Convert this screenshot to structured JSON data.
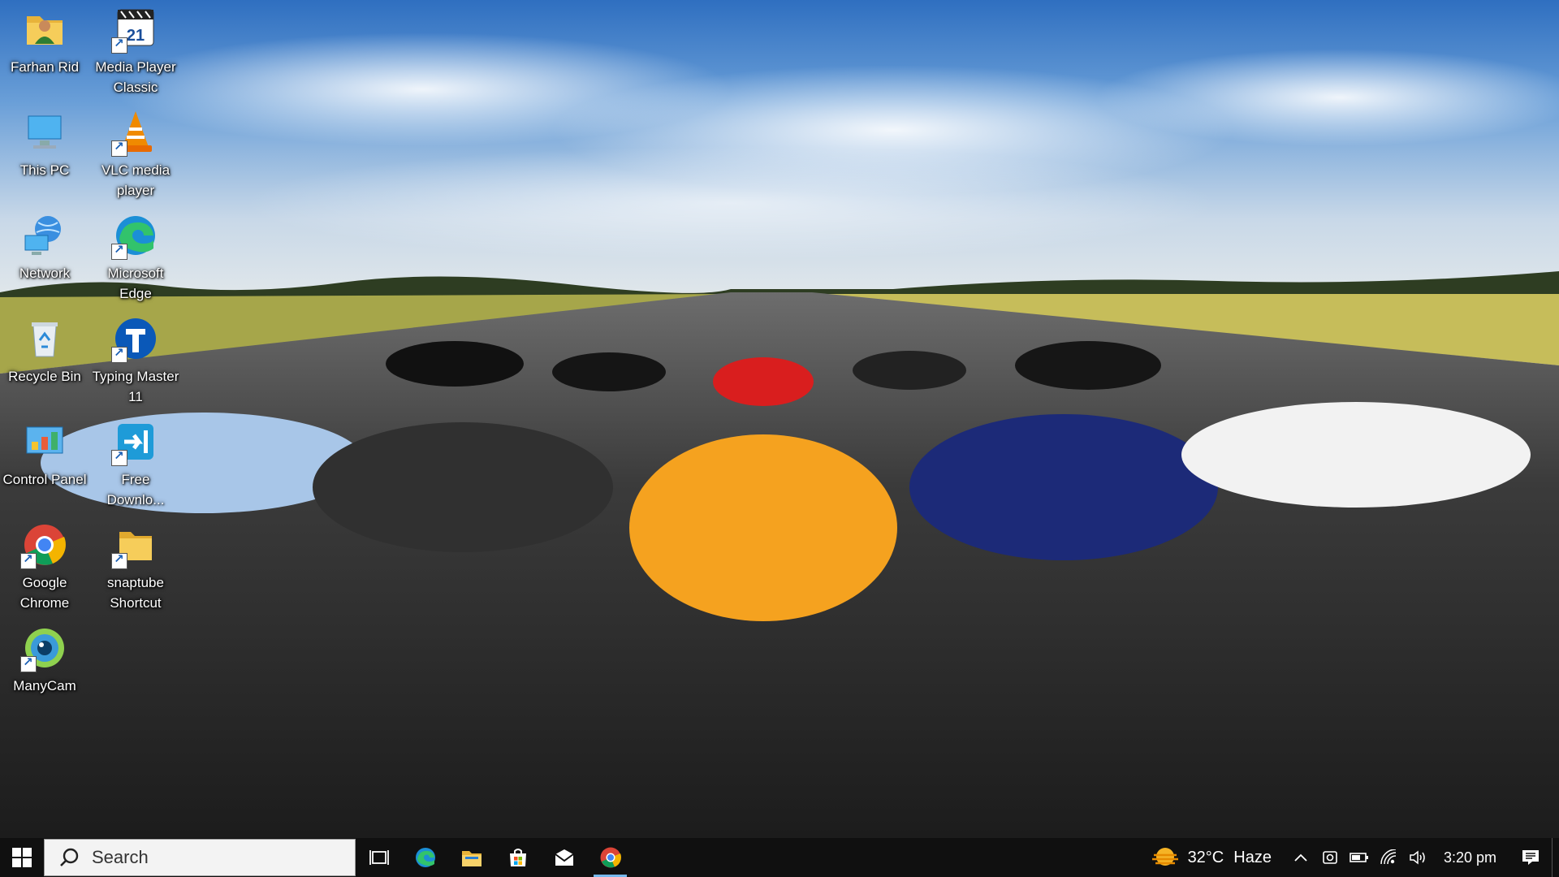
{
  "desktop": {
    "icons": [
      {
        "label": "Farhan Rid",
        "icon": "user-folder-icon"
      },
      {
        "label": "Media Player Classic",
        "icon": "media-player-classic-icon"
      },
      {
        "label": "This PC",
        "icon": "this-pc-icon"
      },
      {
        "label": "VLC media player",
        "icon": "vlc-icon"
      },
      {
        "label": "Network",
        "icon": "network-icon"
      },
      {
        "label": "Microsoft Edge",
        "icon": "edge-icon"
      },
      {
        "label": "Recycle Bin",
        "icon": "recycle-bin-icon"
      },
      {
        "label": "Typing Master 11",
        "icon": "typing-master-icon"
      },
      {
        "label": "Control Panel",
        "icon": "control-panel-icon"
      },
      {
        "label": "Free Downlo...",
        "icon": "free-download-manager-icon"
      },
      {
        "label": "Google Chrome",
        "icon": "chrome-icon"
      },
      {
        "label": "snaptube Shortcut",
        "icon": "folder-shortcut-icon"
      },
      {
        "label": "ManyCam",
        "icon": "manycam-icon"
      }
    ],
    "mpc_badge": "21"
  },
  "taskbar": {
    "search_placeholder": "Search",
    "apps": [
      "task-view-icon",
      "edge-icon",
      "file-explorer-icon",
      "store-icon",
      "mail-icon",
      "chrome-icon"
    ],
    "active_app": "chrome-icon",
    "weather": {
      "temp": "32°C",
      "condition": "Haze"
    },
    "clock": "3:20 pm"
  },
  "colors": {
    "taskbar_bg": "#101010",
    "active_indicator": "#76b9ed",
    "sky": "#3d7bc4",
    "grass": "#b4b24e",
    "runway": "#2c2c2c"
  }
}
